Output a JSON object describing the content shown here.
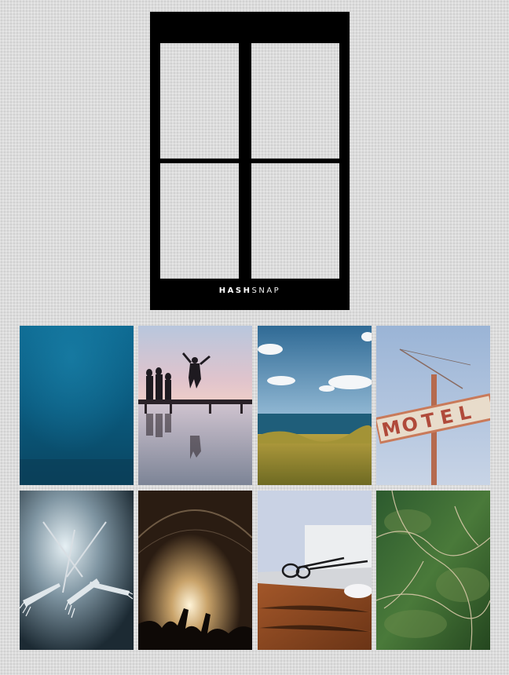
{
  "frame": {
    "brand_bold": "HASH",
    "brand_light": "SNAP",
    "layout": "2x2",
    "background_color": "#000000"
  },
  "photos": [
    {
      "subject": "underwater-ocean"
    },
    {
      "subject": "pier-silhouettes-jump"
    },
    {
      "subject": "coastal-grass-sea"
    },
    {
      "subject": "motel-sign"
    },
    {
      "subject": "forks-closeup"
    },
    {
      "subject": "concert-crowd-lights"
    },
    {
      "subject": "laptop-glasses-desk"
    },
    {
      "subject": "aerial-green-landscape"
    }
  ]
}
